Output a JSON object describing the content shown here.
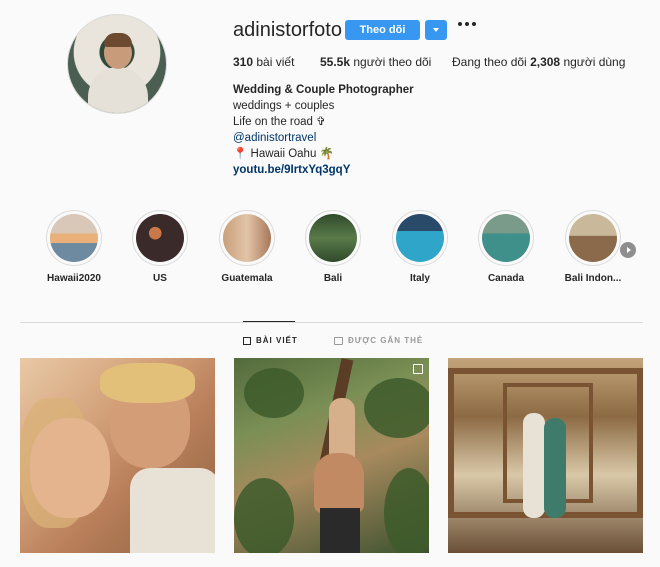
{
  "profile": {
    "username": "adinistorfoto",
    "follow_label": "Theo dõi",
    "stats": {
      "posts_count": "310",
      "posts_label": "bài viết",
      "followers_count": "55.5k",
      "followers_label": "người theo dõi",
      "following_prefix": "Đang theo dõi",
      "following_count": "2,308",
      "following_suffix": "người dùng"
    },
    "bio": {
      "name": "Wedding & Couple Photographer",
      "line1": "weddings + couples",
      "line2": "Life on the road ✞",
      "tag": "@adinistortravel",
      "location": "📍 Hawaii Oahu 🌴",
      "url": "youtu.be/9IrtxYq3gqY"
    }
  },
  "highlights": [
    {
      "label": "Hawaii2020",
      "color": "#e9b07a"
    },
    {
      "label": "US",
      "color": "#3a2a2a"
    },
    {
      "label": "Guatemala",
      "color": "#c99f7a"
    },
    {
      "label": "Bali",
      "color": "#2f4a2a"
    },
    {
      "label": "Italy",
      "color": "#2fa6c9"
    },
    {
      "label": "Canada",
      "color": "#3f8f8a"
    },
    {
      "label": "Bali Indon...",
      "color": "#8a6a4a"
    }
  ],
  "tabs": {
    "posts": "BÀI VIẾT",
    "tagged": "ĐƯỢC GẮN THẺ"
  },
  "icons": {
    "more": "more-dots-icon",
    "dropdown": "chevron-down-icon",
    "grid": "grid-icon",
    "tag": "tagged-icon",
    "next": "chevron-right-icon"
  },
  "colors": {
    "accent": "#3897f0",
    "link": "#003569"
  }
}
